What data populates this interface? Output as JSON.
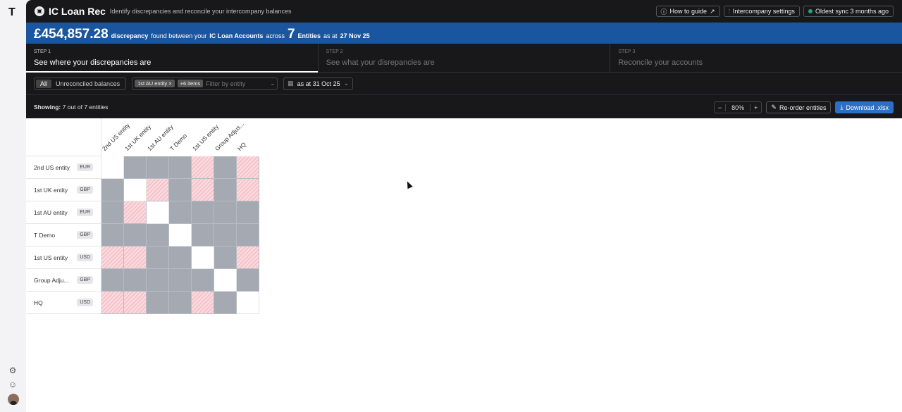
{
  "sidebar": {
    "logo": "T",
    "icons": [
      "settings-icon",
      "support-icon"
    ]
  },
  "header": {
    "title": "IC Loan Rec",
    "subtitle": "Identify discrepancies and reconcile your intercompany balances",
    "how_to": "How to guide",
    "settings": "Intercompany settings",
    "sync": "Oldest sync 3 months ago"
  },
  "banner": {
    "amount": "£454,857.28",
    "t1": "discrepancy",
    "t2": "found between your",
    "accounts": "IC Loan Accounts",
    "t3": "across",
    "count": "7",
    "entities": "Entities",
    "t4": "as at",
    "date": "27 Nov 25"
  },
  "steps": [
    {
      "n": "STEP 1",
      "t": "See where your discrepancies are"
    },
    {
      "n": "STEP 2",
      "t": "See what your disrepancies are"
    },
    {
      "n": "STEP 3",
      "t": "Reconcile your accounts"
    }
  ],
  "filters": {
    "all": "All",
    "unreconciled": "Unreconciled balances",
    "chip": "1st AU entity",
    "more": "+6 items",
    "placeholder": "Filter by entity",
    "date": "as at 31 Oct 25"
  },
  "showing": {
    "label": "Showing:",
    "value": "7 out of 7 entities"
  },
  "tools": {
    "zoom": "80%",
    "reorder": "Re-order entities",
    "download": "Download .xlsx"
  },
  "matrix": {
    "columns": [
      "2nd US entity",
      "1st UK entity",
      "1st AU entity",
      "T Demo",
      "1st US entity",
      "Group Adjus...",
      "HQ"
    ],
    "rows": [
      {
        "name": "2nd US entity",
        "cur": "EUR"
      },
      {
        "name": "1st UK entity",
        "cur": "GBP"
      },
      {
        "name": "1st AU entity",
        "cur": "EUR"
      },
      {
        "name": "T Demo",
        "cur": "GBP"
      },
      {
        "name": "1st US entity",
        "cur": "USD"
      },
      {
        "name": "Group Adju...",
        "cur": "GBP"
      },
      {
        "name": "HQ",
        "cur": "USD"
      }
    ],
    "states": [
      "dgggpgp",
      "gdpgpgp",
      "gpdgggg",
      "gggdggg",
      "ppggdgp",
      "gggggdg",
      "ppggpgd"
    ],
    "legend": {
      "d": "self",
      "g": "no discrepancy",
      "p": "discrepancy"
    }
  }
}
